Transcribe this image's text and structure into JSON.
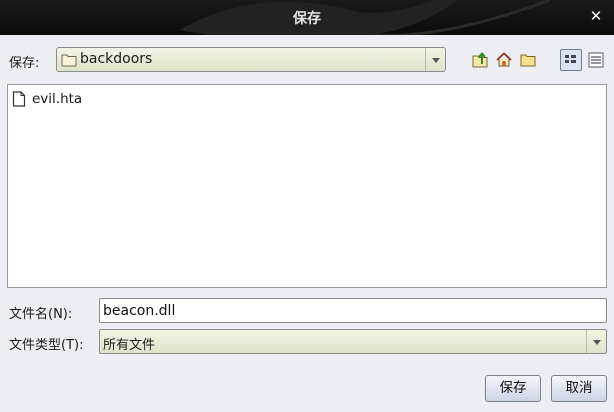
{
  "window": {
    "title": "保存",
    "close_glyph": "✕"
  },
  "save_in": {
    "label": "保存:",
    "current_folder": "backdoors"
  },
  "toolbar": {
    "up_folder_icon": "folder-up-icon",
    "home_icon": "home-icon",
    "new_folder_icon": "new-folder-icon",
    "list_view_icon": "list-view-icon",
    "details_view_icon": "details-view-icon"
  },
  "files": [
    {
      "name": "evil.hta",
      "icon": "file-icon"
    }
  ],
  "filename": {
    "label": "文件名(N):",
    "value": "beacon.dll"
  },
  "filetype": {
    "label": "文件类型(T):",
    "value": "所有文件"
  },
  "buttons": {
    "save": "保存",
    "cancel": "取消"
  },
  "colors": {
    "titlebar": "#111111",
    "combo": "#e7eace",
    "background": "#eceef4"
  }
}
